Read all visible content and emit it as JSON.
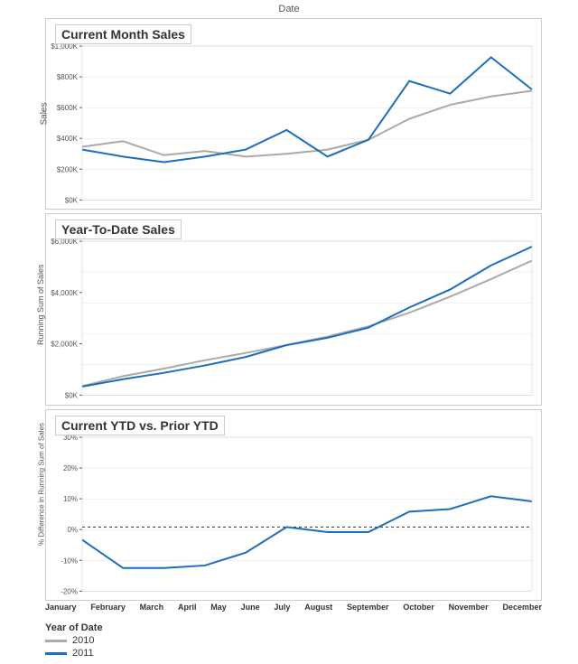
{
  "header": {
    "date_label": "Date"
  },
  "charts": [
    {
      "id": "current-month",
      "title": "Current Month Sales",
      "y_axis_label": "Sales",
      "y_ticks": [
        "$1,000K",
        "$800K",
        "$600K",
        "$400K",
        "$200K",
        "$0K"
      ],
      "series": {
        "2010": [
          380,
          420,
          320,
          350,
          310,
          330,
          360,
          430,
          580,
          680,
          740,
          780
        ],
        "2011": [
          360,
          310,
          270,
          310,
          360,
          500,
          310,
          430,
          850,
          760,
          1020,
          790
        ]
      },
      "colors": {
        "2010": "#aaa",
        "2011": "#1a6ebd"
      },
      "y_min": 0,
      "y_max": 1100
    },
    {
      "id": "ytd",
      "title": "Year-To-Date Sales",
      "y_axis_label": "Running Sum of Sales",
      "y_ticks": [
        "$6,000K",
        "$4,000K",
        "$2,000K",
        "$0K"
      ],
      "series": {
        "2010": [
          380,
          800,
          1120,
          1470,
          1780,
          2110,
          2470,
          2900,
          3480,
          4160,
          4900,
          5680
        ],
        "2011": [
          360,
          670,
          940,
          1250,
          1610,
          2110,
          2420,
          2850,
          3700,
          4460,
          5480,
          6270
        ]
      },
      "colors": {
        "2010": "#aaa",
        "2011": "#1a6ebd"
      },
      "y_min": 0,
      "y_max": 6500
    },
    {
      "id": "ytd-comparison",
      "title": "Current YTD vs. Prior YTD",
      "y_axis_label": "% Difference in Running Sum of Sales",
      "y_ticks": [
        "30%",
        "20%",
        "10%",
        "0%",
        "-10%",
        "-20%"
      ],
      "series": {
        "diff": [
          -5,
          -16,
          -16,
          -15,
          -10,
          0,
          -2,
          -2,
          6,
          7,
          12,
          10
        ]
      },
      "colors": {
        "diff": "#1a6ebd"
      },
      "y_min": -25,
      "y_max": 35,
      "zero_line": true
    }
  ],
  "x_months": [
    "January",
    "February",
    "March",
    "April",
    "May",
    "June",
    "July",
    "August",
    "September",
    "October",
    "November",
    "December"
  ],
  "legend": {
    "title": "Year of Date",
    "items": [
      {
        "label": "2010",
        "color": "#aaa"
      },
      {
        "label": "2011",
        "color": "#1a6ebd"
      }
    ]
  }
}
